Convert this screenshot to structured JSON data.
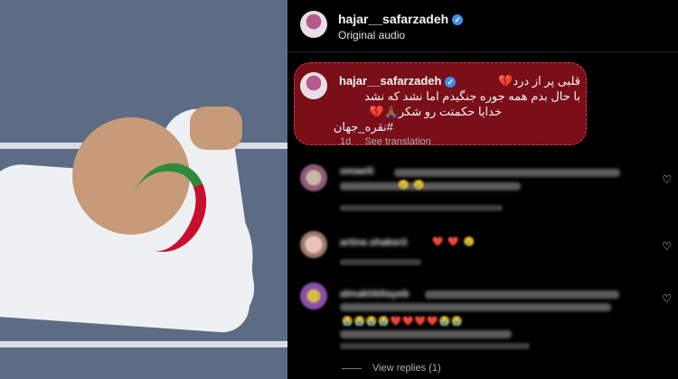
{
  "header": {
    "username": "hajar__safarzadeh",
    "subtitle": "Original audio"
  },
  "caption": {
    "username": "hajar__safarzadeh",
    "line1": "قلبی پر از درد💔",
    "line2": "با حال بدم همه جوره جنگیدم اما نشد که نشد",
    "line3": "خدایا حکمتت رو شکر🙏🏾💔",
    "hashtag": "#نقره_جهان",
    "time": "1d",
    "see_translation": "See translation"
  },
  "comments": [
    {
      "username": "smaeili",
      "emojis": "😢 😢"
    },
    {
      "username": "artine.shakerii",
      "emojis": "❤️ ❤️ 😢"
    },
    {
      "username": "almakhbltayeb",
      "emojis": "😭😭😭😭❤️❤️❤️❤️😭😭"
    }
  ],
  "view_replies": "View replies (1)",
  "colors": {
    "accent": "#3b8ef0",
    "highlight": "#7a0f18"
  }
}
